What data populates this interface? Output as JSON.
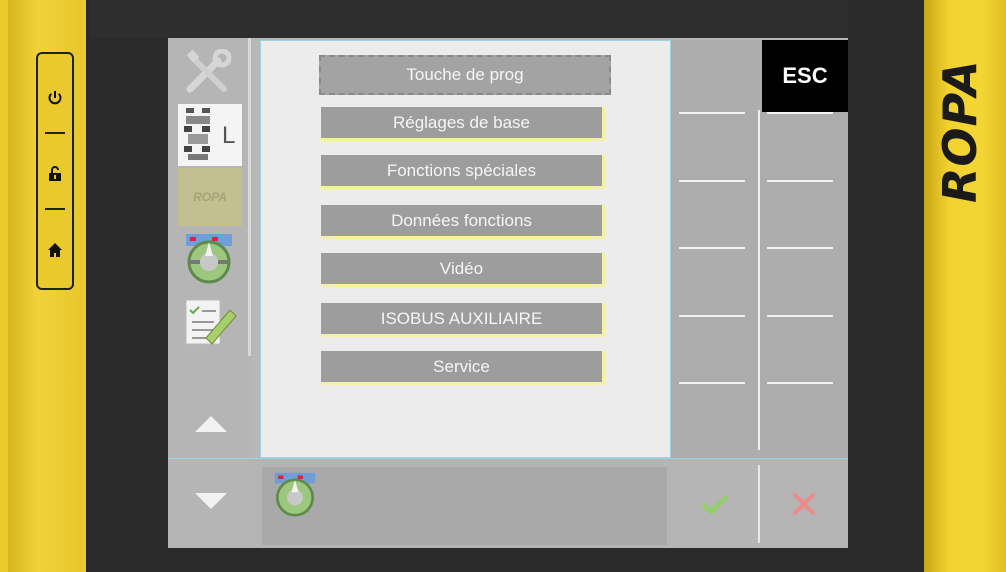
{
  "brand": {
    "logo_text": "ROPA",
    "side_logo_text": "ROPA"
  },
  "hardware_buttons": [
    {
      "name": "power",
      "icon": "power-icon"
    },
    {
      "name": "lock",
      "icon": "unlock-icon"
    },
    {
      "name": "home",
      "icon": "home-icon"
    }
  ],
  "sidebar": {
    "items": [
      {
        "icon": "tools-icon"
      },
      {
        "icon": "machine-layout-icon",
        "label": "L"
      },
      {
        "icon": "ropa-logo-icon",
        "label": "ROPA"
      },
      {
        "icon": "steering-wheel-icon"
      },
      {
        "icon": "checklist-edit-icon"
      }
    ]
  },
  "menu": {
    "items": [
      {
        "label": "Touche de prog"
      },
      {
        "label": "Réglages de base"
      },
      {
        "label": "Fonctions spéciales"
      },
      {
        "label": "Données fonctions"
      },
      {
        "label": "Vidéo"
      },
      {
        "label": "ISOBUS AUXILIAIRE"
      },
      {
        "label": "Service"
      }
    ],
    "focused_index": 0
  },
  "softkeys": {
    "esc_label": "ESC"
  },
  "bottom": {
    "confirm_icon": "check-icon",
    "cancel_icon": "close-icon",
    "status_icon": "steering-wheel-icon"
  },
  "colors": {
    "accent_yellow": "#f2d030",
    "button_gray": "#9d9d9d",
    "check_green": "#8fd35f",
    "cancel_red": "#ef8a8a"
  }
}
